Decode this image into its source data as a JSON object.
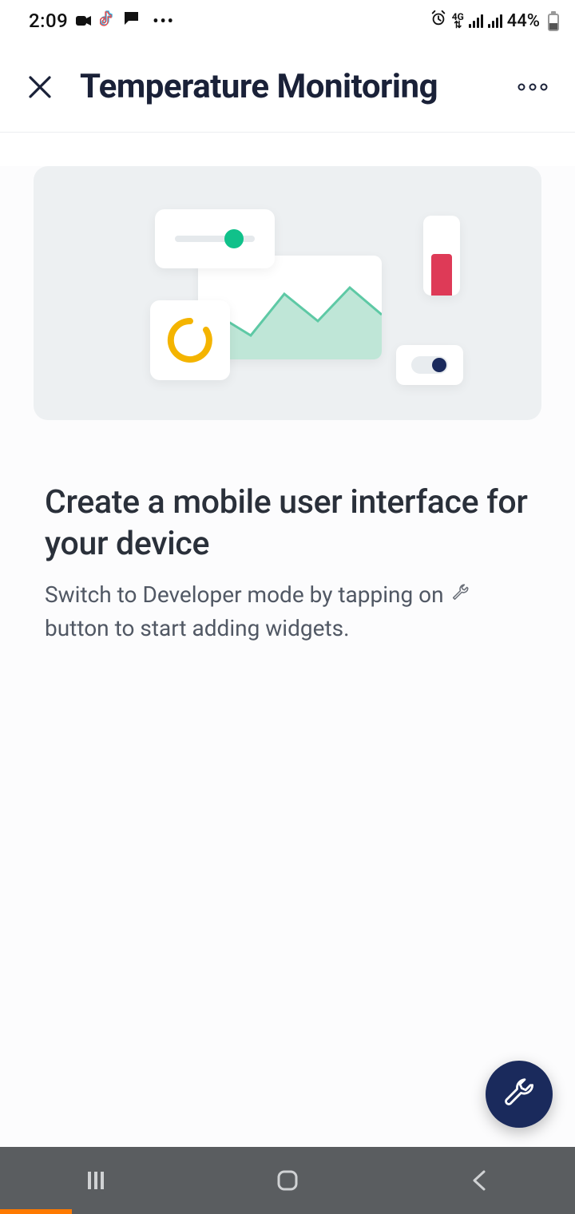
{
  "status": {
    "time": "2:09",
    "network_label": "4G",
    "battery_text": "44%"
  },
  "header": {
    "title": "Temperature Monitoring"
  },
  "main": {
    "headline": "Create a mobile user interface for your device",
    "subtext_before": "Switch to Developer mode by tapping on ",
    "subtext_after": " button to start adding widgets."
  },
  "icons": {
    "close": "close-icon",
    "more": "more-icon",
    "wrench": "wrench-icon"
  }
}
